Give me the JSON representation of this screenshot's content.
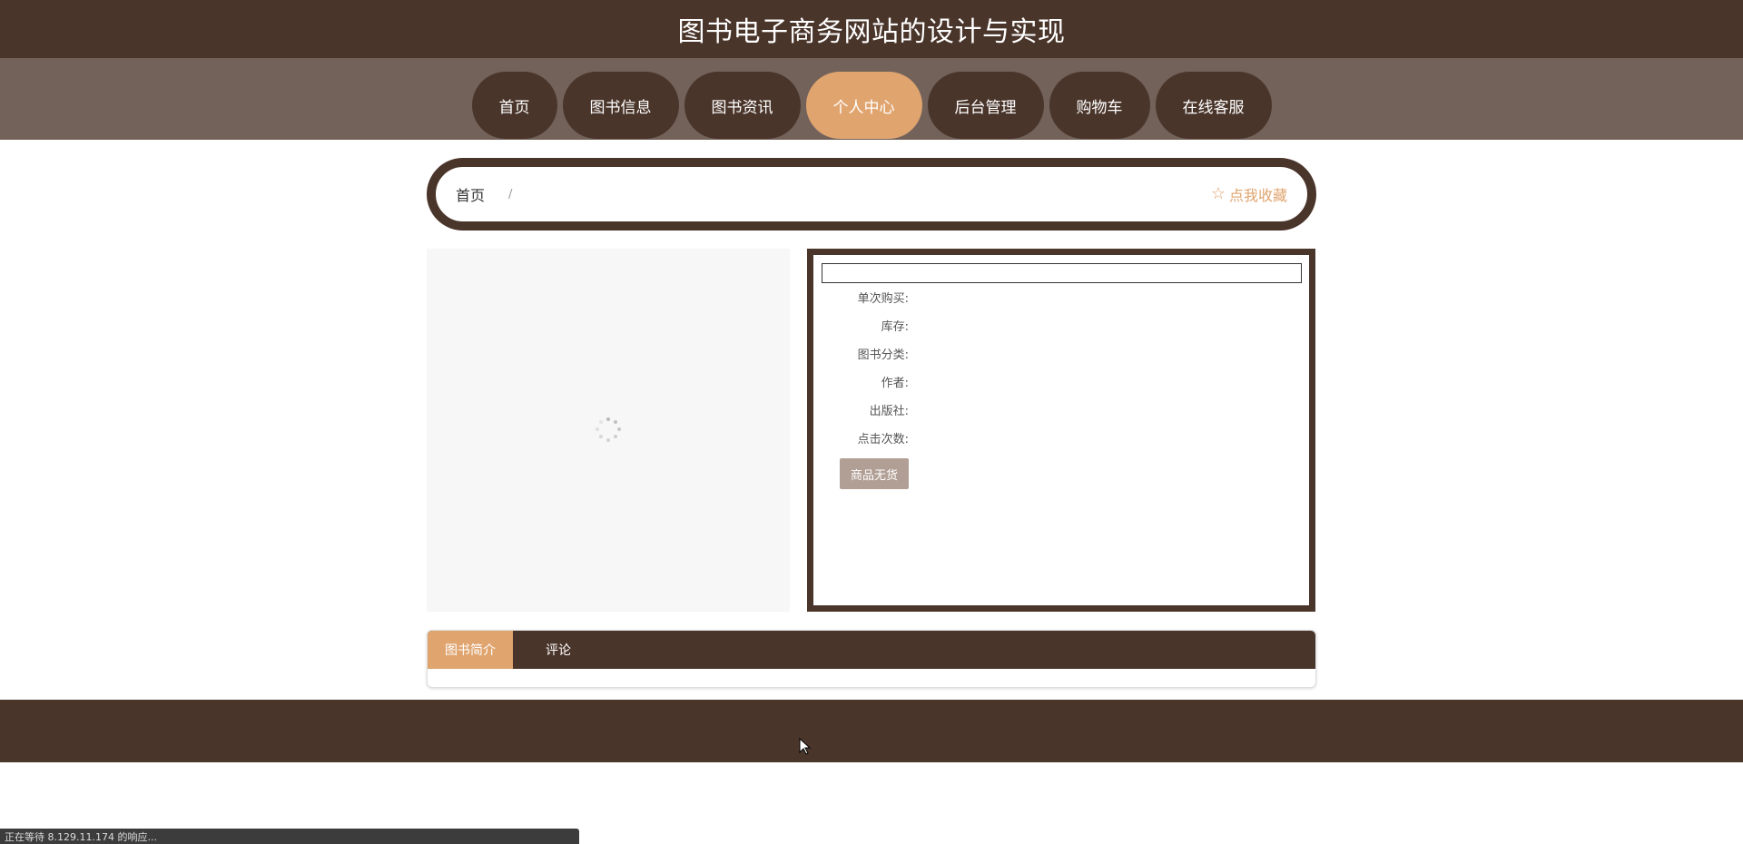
{
  "header": {
    "site_title": "图书电子商务网站的设计与实现"
  },
  "nav": {
    "items": [
      {
        "label": "首页",
        "active": false
      },
      {
        "label": "图书信息",
        "active": false
      },
      {
        "label": "图书资讯",
        "active": false
      },
      {
        "label": "个人中心",
        "active": true
      },
      {
        "label": "后台管理",
        "active": false
      },
      {
        "label": "购物车",
        "active": false
      },
      {
        "label": "在线客服",
        "active": false
      }
    ]
  },
  "breadcrumb": {
    "home": "首页",
    "separator": "/",
    "favorite_label": "点我收藏",
    "favorite_icon": "star-outline-icon"
  },
  "product": {
    "image_state": "loading",
    "title": "",
    "fields": [
      {
        "label": "单次购买:",
        "value": ""
      },
      {
        "label": "库存:",
        "value": ""
      },
      {
        "label": "图书分类:",
        "value": ""
      },
      {
        "label": "作者:",
        "value": ""
      },
      {
        "label": "出版社:",
        "value": ""
      },
      {
        "label": "点击次数:",
        "value": ""
      }
    ],
    "soldout_button": "商品无货"
  },
  "tabs": [
    {
      "label": "图书简介",
      "active": true
    },
    {
      "label": "评论",
      "active": false
    }
  ],
  "status_bar": {
    "text": "正在等待 8.129.11.174 的响应..."
  },
  "colors": {
    "primary_brown": "#4a352b",
    "nav_bg": "#73625a",
    "accent_orange": "#e0a46f",
    "disabled_button": "#b19f95"
  }
}
